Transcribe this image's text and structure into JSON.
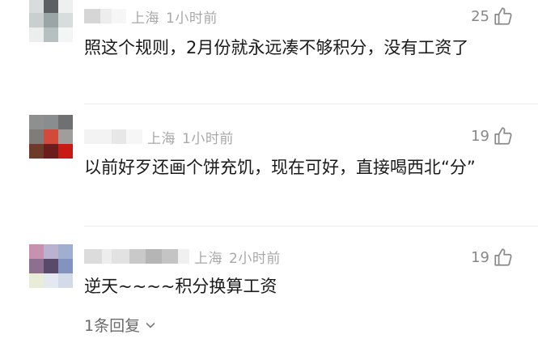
{
  "comments": [
    {
      "location": "上海",
      "time": "1小时前",
      "likes": "25",
      "text": "照这个规则，2月份就永远凑不够积分，没有工资了"
    },
    {
      "location": "上海",
      "time": "1小时前",
      "likes": "19",
      "text": "以前好歹还画个饼充饥，现在可好，直接喝西北“分”"
    },
    {
      "location": "上海",
      "time": "2小时前",
      "likes": "19",
      "text": "逆天~~~~积分换算工资"
    }
  ],
  "reply_link": {
    "label": "1条回复"
  },
  "icons": {
    "like": "thumbs-up-icon",
    "expand": "chevron-down-icon"
  },
  "colors": {
    "meta_text": "#a8a8a8",
    "body_text": "#1a1a1a",
    "like_count": "#888888"
  }
}
